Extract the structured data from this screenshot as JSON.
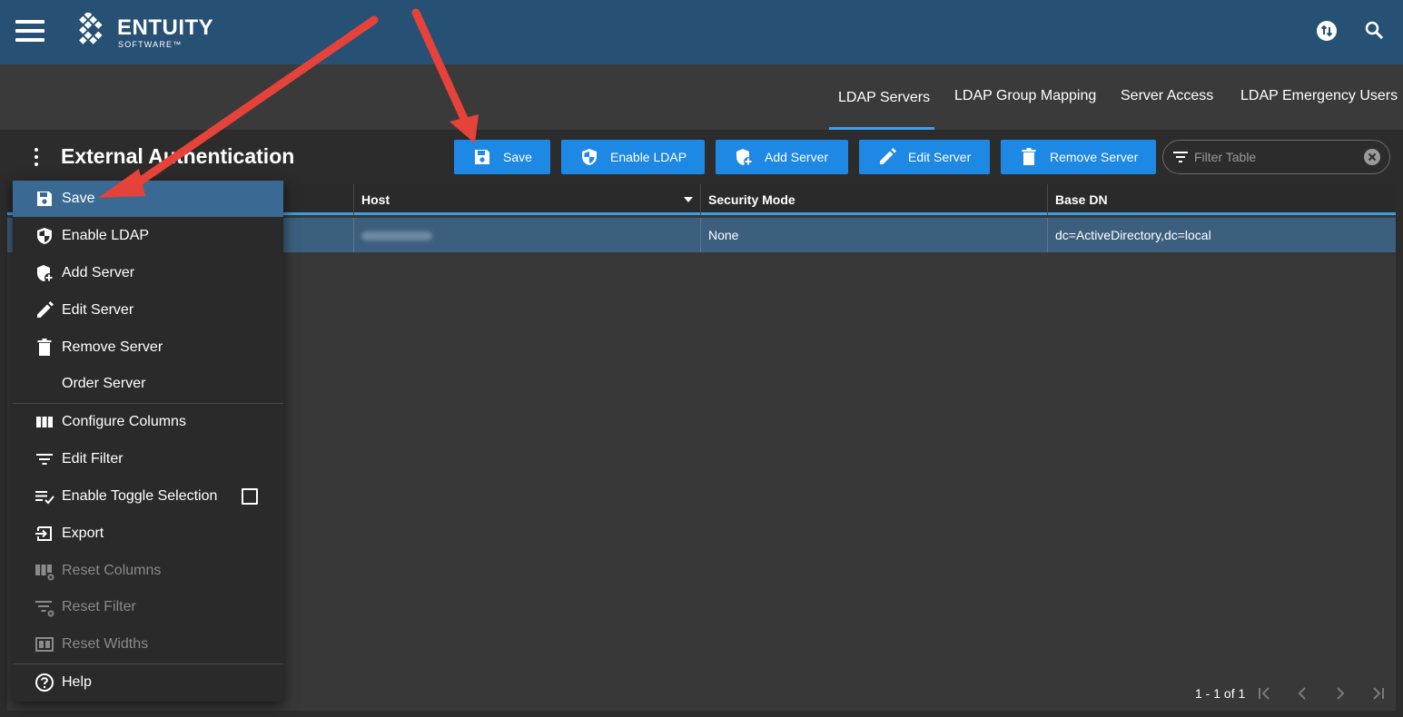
{
  "app": {
    "brand": "ENTUITY",
    "brand_sub": "SOFTWARE™"
  },
  "tabs": [
    {
      "label": "LDAP Servers",
      "active": true
    },
    {
      "label": "LDAP Group Mapping",
      "active": false
    },
    {
      "label": "Server Access",
      "active": false
    },
    {
      "label": "LDAP Emergency Users",
      "active": false
    }
  ],
  "page": {
    "title": "External Authentication"
  },
  "toolbar": {
    "save": "Save",
    "enable_ldap": "Enable LDAP",
    "add_server": "Add Server",
    "edit_server": "Edit Server",
    "remove_server": "Remove Server",
    "filter_placeholder": "Filter Table"
  },
  "table": {
    "columns": [
      "Host",
      "Security Mode",
      "Base DN"
    ],
    "rows": [
      {
        "host": "",
        "security_mode": "None",
        "base_dn": "dc=ActiveDirectory,dc=local"
      }
    ],
    "pagination": "1 - 1 of 1"
  },
  "menu": {
    "items": [
      {
        "label": "Save",
        "icon": "floppy-disk-icon",
        "selected": true
      },
      {
        "label": "Enable LDAP",
        "icon": "shield-icon"
      },
      {
        "label": "Add Server",
        "icon": "shield-plus-icon"
      },
      {
        "label": "Edit Server",
        "icon": "pencil-icon"
      },
      {
        "label": "Remove Server",
        "icon": "trash-icon"
      },
      {
        "label": "Order Server"
      },
      {
        "label": "Configure Columns",
        "icon": "columns-icon"
      },
      {
        "label": "Edit Filter",
        "icon": "filter-icon"
      },
      {
        "label": "Enable Toggle Selection",
        "icon": "checklist-icon"
      },
      {
        "label": "Export",
        "icon": "export-icon"
      },
      {
        "label": "Reset Columns",
        "icon": "reset-columns-icon",
        "disabled": true
      },
      {
        "label": "Reset Filter",
        "icon": "reset-filter-icon",
        "disabled": true
      },
      {
        "label": "Reset Widths",
        "icon": "reset-widths-icon",
        "disabled": true
      },
      {
        "label": "Help",
        "icon": "help-circle-icon"
      }
    ]
  },
  "colors": {
    "appbar": "#275075",
    "tabbar": "#3a3a3a",
    "accent": "#1e88e5",
    "tab_underline": "#3d9fe6",
    "selected_row": "#3d5f7e",
    "menu_selected": "#3a6a93",
    "annotation_arrow": "#e5423a"
  }
}
